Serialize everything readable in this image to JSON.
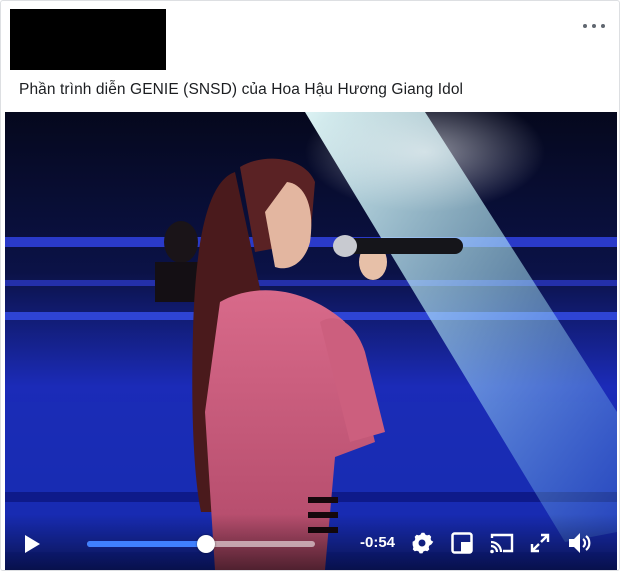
{
  "post": {
    "text": "Phần trình diễn GENIE (SNSD) của Hoa Hậu Hương Giang Idol"
  },
  "header": {
    "more_icon": "more-horizontal-icon"
  },
  "player": {
    "remaining_time": "-0:54",
    "progress_fraction": 0.52,
    "accent_color": "#4080ff",
    "icons": [
      "play-icon",
      "gear-icon",
      "picture-in-picture-icon",
      "cast-icon",
      "fullscreen-icon",
      "volume-icon"
    ]
  }
}
